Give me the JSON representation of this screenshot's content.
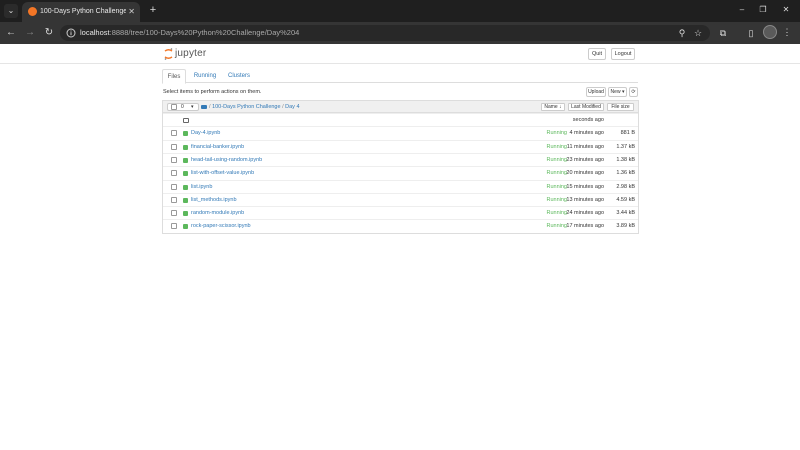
{
  "browser": {
    "tab_title": "100-Days Python Challenge/D",
    "tab_close": "✕",
    "new_tab": "+",
    "url_host": "localhost",
    "url_rest": ":8888/tree/100-Days%20Python%20Challenge/Day%204",
    "icons": [
      "chevron-down-icon",
      "arrow-left-icon",
      "arrow-right-icon",
      "reload-icon",
      "info-icon",
      "zoom-icon",
      "star-icon",
      "extensions-icon",
      "sidepanel-icon",
      "profile-icon",
      "kebab-menu-icon",
      "minimize-icon",
      "maximize-icon",
      "close-icon"
    ]
  },
  "header": {
    "logo_text": "jupyter",
    "quit_label": "Quit",
    "logout_label": "Logout"
  },
  "tabs": [
    {
      "label": "Files",
      "active": true
    },
    {
      "label": "Running",
      "active": false
    },
    {
      "label": "Clusters",
      "active": false
    }
  ],
  "toolbar": {
    "select_hint": "Select items to perform actions on them.",
    "upload_label": "Upload",
    "new_label": "New ▾",
    "refresh_icon": "⟳"
  },
  "list_header": {
    "selected_count": "0",
    "breadcrumb_root": "/",
    "breadcrumb_parent": "100-Days Python Challenge",
    "breadcrumb_sep": "/",
    "breadcrumb_current": "Day 4",
    "name_sort": "Name ↓",
    "modified_sort": "Last Modified",
    "size_sort": "File size"
  },
  "parent_row": {
    "modified": "seconds ago"
  },
  "files": [
    {
      "name": "Day-4.ipynb",
      "status": "Running",
      "modified": "4 minutes ago",
      "size": "881 B"
    },
    {
      "name": "financial-banker.ipynb",
      "status": "Running",
      "modified": "11 minutes ago",
      "size": "1.37 kB"
    },
    {
      "name": "head-tail-using-random.ipynb",
      "status": "Running",
      "modified": "23 minutes ago",
      "size": "1.38 kB"
    },
    {
      "name": "list-with-offset-value.ipynb",
      "status": "Running",
      "modified": "20 minutes ago",
      "size": "1.36 kB"
    },
    {
      "name": "list.ipynb",
      "status": "Running",
      "modified": "15 minutes ago",
      "size": "2.98 kB"
    },
    {
      "name": "list_methods.ipynb",
      "status": "Running",
      "modified": "13 minutes ago",
      "size": "4.59 kB"
    },
    {
      "name": "random-module.ipynb",
      "status": "Running",
      "modified": "24 minutes ago",
      "size": "3.44 kB"
    },
    {
      "name": "rock-paper-scissor.ipynb",
      "status": "Running",
      "modified": "17 minutes ago",
      "size": "3.89 kB"
    }
  ],
  "colors": {
    "link": "#337ab7",
    "running": "#5cb85c",
    "jupyter_orange": "#f37626"
  }
}
